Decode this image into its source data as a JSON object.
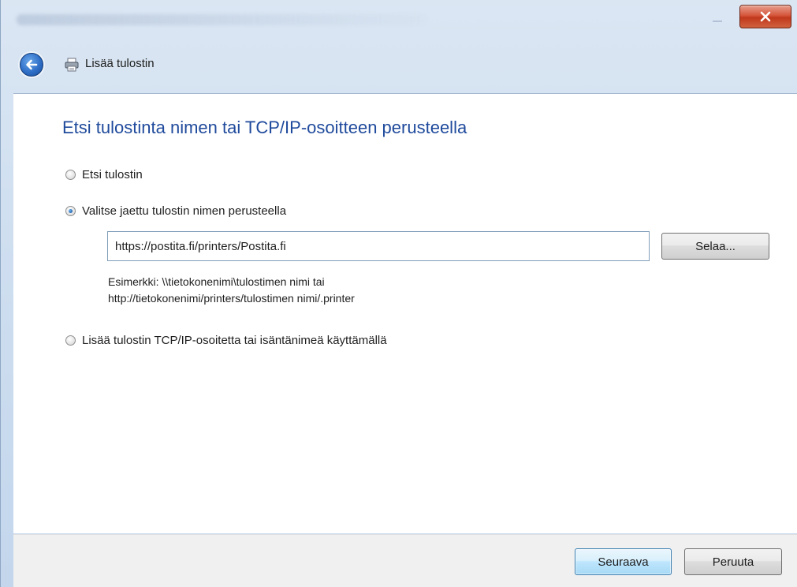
{
  "window": {
    "title": "Lisää tulostin"
  },
  "titlebar": {
    "close_label": "x"
  },
  "page": {
    "heading": "Etsi tulostinta nimen tai TCP/IP-osoitteen perusteella",
    "options": [
      {
        "label": "Etsi tulostin",
        "checked": false
      },
      {
        "label": "Valitse jaettu tulostin nimen perusteella",
        "checked": true
      },
      {
        "label": "Lisää tulostin TCP/IP-osoitetta tai isäntänimeä käyttämällä",
        "checked": false
      }
    ],
    "shared_printer": {
      "value": "https://postita.fi/printers/Postita.fi",
      "browse_label": "Selaa...",
      "hint_line1": "Esimerkki: \\\\tietokonenimi\\tulostimen nimi tai",
      "hint_line2": "http://tietokonenimi/printers/tulostimen nimi/.printer"
    }
  },
  "footer": {
    "next_label": "Seuraava",
    "cancel_label": "Peruuta"
  },
  "colors": {
    "heading": "#1f4a9c",
    "close_red": "#c0381c",
    "accent_blue": "#2f6fc7"
  },
  "icons": {
    "back": "back-arrow-icon",
    "printer": "printer-icon",
    "close": "close-icon"
  }
}
